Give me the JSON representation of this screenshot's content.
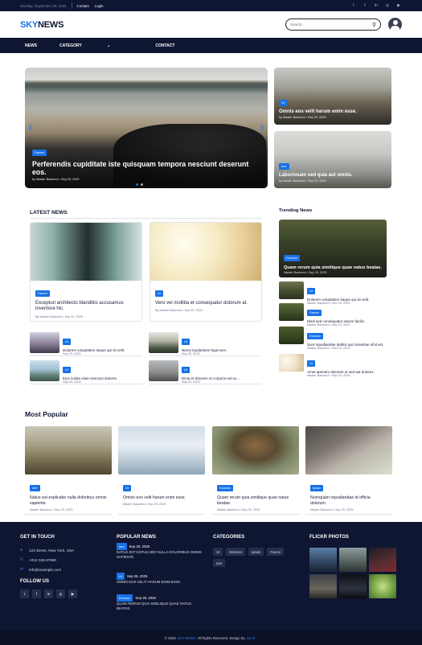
{
  "topbar": {
    "date": "Monday, September 29, 2025",
    "links": [
      "Contact",
      "Login"
    ],
    "socials": [
      "twitter-icon",
      "facebook-icon",
      "linkedin-icon",
      "instagram-icon",
      "youtube-icon"
    ]
  },
  "brand": {
    "part1": "SKY",
    "part2": "NEWS",
    "accent": "#1772e8",
    "navy": "#0f1631"
  },
  "search": {
    "placeholder": "Search..."
  },
  "nav": {
    "items": [
      "NEWS",
      "CATEGORY",
      "CONTACT"
    ]
  },
  "hero": {
    "badge": "Facere",
    "title": "Perferendis cupiditate iste quisquam tempora nesciunt deserunt eos.",
    "meta": "by Master Backend • Sep 29, 2025"
  },
  "side_news": [
    {
      "badge": "Ut",
      "title": "Omnis eos velit harum enim esse.",
      "meta": "by Master Backend • Sep 29, 2025"
    },
    {
      "badge": "Iure",
      "title": "Laboriosam sed quia aut omnis.",
      "meta": "by Master Backend • Sep 29, 2025"
    }
  ],
  "latest": {
    "heading": "LATEST NEWS",
    "cards": [
      {
        "badge": "Facere",
        "title": "Excepturi architecto blanditiis accusamus inventore hic.",
        "meta": "By Master Backend • Sep 29, 2025"
      },
      {
        "badge": "Ut",
        "title": "Vero vel mollitia et consequatur dolorum at.",
        "meta": "By Master Backend • Sep 29, 2025"
      }
    ],
    "list": [
      {
        "badge": "Ut",
        "title": "Dolorem voluptatem itaque qui sit velit.",
        "meta": "Sep 29, 2025"
      },
      {
        "badge": "Ut",
        "title": "Nemo laudantium fugit eum.",
        "meta": "Sep 29, 2025"
      },
      {
        "badge": "Ut",
        "title": "Eius soluta vitae nesciunt dolores.",
        "meta": "Sep 29, 2025"
      },
      {
        "badge": "Ut",
        "title": "Dicta et dolorem et corporis est ex...",
        "meta": "Sep 29, 2025"
      }
    ]
  },
  "trending": {
    "heading": "Trending News",
    "featured": {
      "badge": "Dolorum",
      "title": "Quam rerum quia similique quae natus beatae.",
      "meta": "Master Backend • Sep 29, 2025"
    },
    "items": [
      {
        "badge": "Ut",
        "title": "Dolorem voluptatem itaque qui sit velit.",
        "meta": "Master Backend • Sep 29, 2025"
      },
      {
        "badge": "Facere",
        "title": "Modi sed consequatur earum facilis.",
        "meta": "Master Backend • Sep 29, 2025"
      },
      {
        "badge": "Dolorum",
        "title": "Sunt repudiandae debitis qui molestiae nihil est.",
        "meta": "Master Backend • Sep 29, 2025"
      },
      {
        "badge": "Ut",
        "title": "Amet aperiam dolorem ut sed aut dolores.",
        "meta": "Master Backend • Sep 29, 2025"
      }
    ]
  },
  "popular": {
    "heading": "Most Popular",
    "items": [
      {
        "badge": "Iure",
        "title": "Natus est explicabo nulla doloribus omnis sapiente.",
        "meta": "Master Backend • Sep 29, 2025"
      },
      {
        "badge": "Ut",
        "title": "Omnis eos velit harum enim esse.",
        "meta": "Master Backend • Sep 29, 2025"
      },
      {
        "badge": "Dolorum",
        "title": "Quam rerum quia similique quae natus beatae.",
        "meta": "Master Backend • Sep 29, 2025"
      },
      {
        "badge": "Ipsam",
        "title": "Numquam repudiandae id officia dolorum.",
        "meta": "Master Backend • Sep 29, 2025"
      }
    ]
  },
  "footer": {
    "touch": {
      "heading": "GET IN TOUCH",
      "address": "123 Street, New York, USA",
      "phone": "+012 345 67890",
      "email": "info@example.com"
    },
    "follow": {
      "heading": "FOLLOW US",
      "icons": [
        "twitter-icon",
        "facebook-icon",
        "linkedin-icon",
        "instagram-icon",
        "youtube-icon"
      ]
    },
    "popular_news": {
      "heading": "POPULAR NEWS",
      "items": [
        {
          "title": "NATUS EST EXPLICABO NULLA DOLORIBUS OMNIS SAPIENTE.",
          "badge": "Ut",
          "date": "Sep 29, 2025"
        },
        {
          "title": "OMNIS EOS VELIT HARUM ENIM ESSE.",
          "badge": "Dolorum",
          "date": "Sep 29, 2025"
        },
        {
          "title": "QUAM RERUM QUIA SIMILIQUE QUAE NATUS BEATAE.",
          "badge": "",
          "date": ""
        }
      ],
      "first_badge": "Iure",
      "first_date": "Sep 29, 2025"
    },
    "categories": {
      "heading": "CATEGORIES",
      "tags": [
        "Ut",
        "Dolorum",
        "Ipsam",
        "Facere",
        "Iure"
      ]
    },
    "flickr": {
      "heading": "FLICKR PHOTOS"
    }
  },
  "copyright": {
    "prefix": "© 2025",
    "brand": "SKY NEWS",
    "middle": "All Rights Reserved. Design by",
    "author": "sol AT"
  }
}
